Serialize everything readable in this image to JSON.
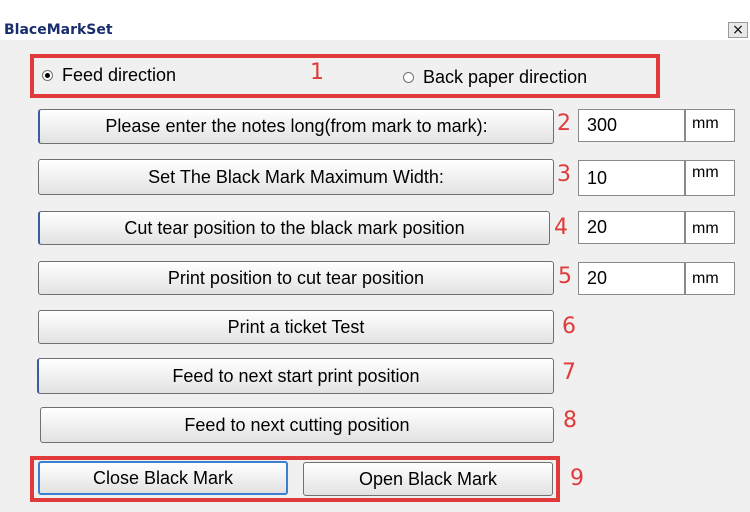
{
  "window": {
    "title": "BlaceMarkSet",
    "close_glyph": "×"
  },
  "direction": {
    "number": "1",
    "options": [
      {
        "label": "Feed direction",
        "selected": true
      },
      {
        "label": "Back paper direction",
        "selected": false
      }
    ]
  },
  "settings": [
    {
      "number": "2",
      "button_label": "Please enter the notes long(from mark to mark):",
      "value": "300",
      "unit": "mm"
    },
    {
      "number": "3",
      "button_label": "Set The Black Mark Maximum Width:",
      "value": "10",
      "unit": "mm"
    },
    {
      "number": "4",
      "button_label": "Cut tear position to the black mark position",
      "value": "20",
      "unit": "mm"
    },
    {
      "number": "5",
      "button_label": "Print position to cut tear position",
      "value": "20",
      "unit": "mm"
    }
  ],
  "actions": [
    {
      "number": "6",
      "label": "Print a ticket Test"
    },
    {
      "number": "7",
      "label": "Feed to next start print position"
    },
    {
      "number": "8",
      "label": "Feed to next cutting position"
    }
  ],
  "mark_toggle": {
    "number": "9",
    "close_label": "Close Black Mark",
    "open_label": "Open Black Mark"
  },
  "colors": {
    "annotation_red": "#e03a3a",
    "title_blue": "#1a2e6e",
    "focus_blue": "#3c7fd0"
  }
}
